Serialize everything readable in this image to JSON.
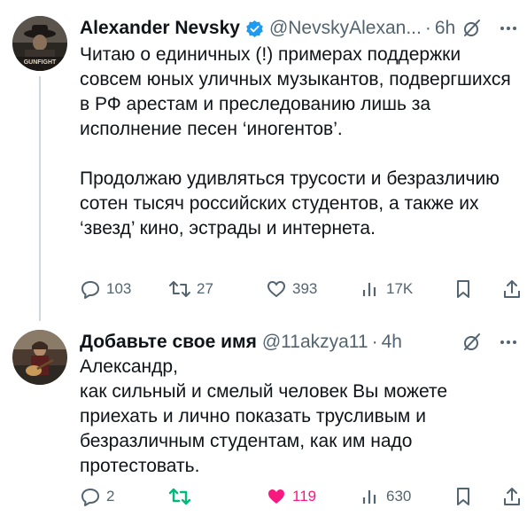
{
  "tweet1": {
    "name": "Alexander Nevsky",
    "handle": "@NevskyAlexan...",
    "dot": "·",
    "time": "6h",
    "avatar_text": "GUNFIGHT",
    "text": "Читаю о единичных (!) примерах поддержки совсем юных уличных музыкантов, подвергшихся в РФ арестам и преследованию лишь за исполнение песен ‘иногентов’.\n\nПродолжаю удивляться трусости и безразличию сотен тысяч российских студентов, а также их ‘звезд’ кино, эстрады и интернета.",
    "replies": "103",
    "reposts": "27",
    "likes": "393",
    "views": "17K"
  },
  "tweet2": {
    "name": "Добавьте свое имя",
    "handle": "@11akzya11",
    "dot": "·",
    "time": "4h",
    "text": "Александр,\nкак сильный и смелый человек Вы можете приехать и лично показать трусливым и безразличным студентам, как им надо протестовать.",
    "replies": "2",
    "likes": "119",
    "views": "630"
  },
  "colors": {
    "text": "#0f1419",
    "muted": "#536471",
    "verified": "#1d9bf0",
    "repost_active": "#00ba7c",
    "like_active": "#f91880",
    "thread_line": "#cfd9de"
  },
  "icons": [
    "verified-badge-icon",
    "grok-icon",
    "more-icon",
    "reply-icon",
    "repost-icon",
    "like-icon",
    "views-icon",
    "bookmark-icon",
    "share-icon"
  ]
}
